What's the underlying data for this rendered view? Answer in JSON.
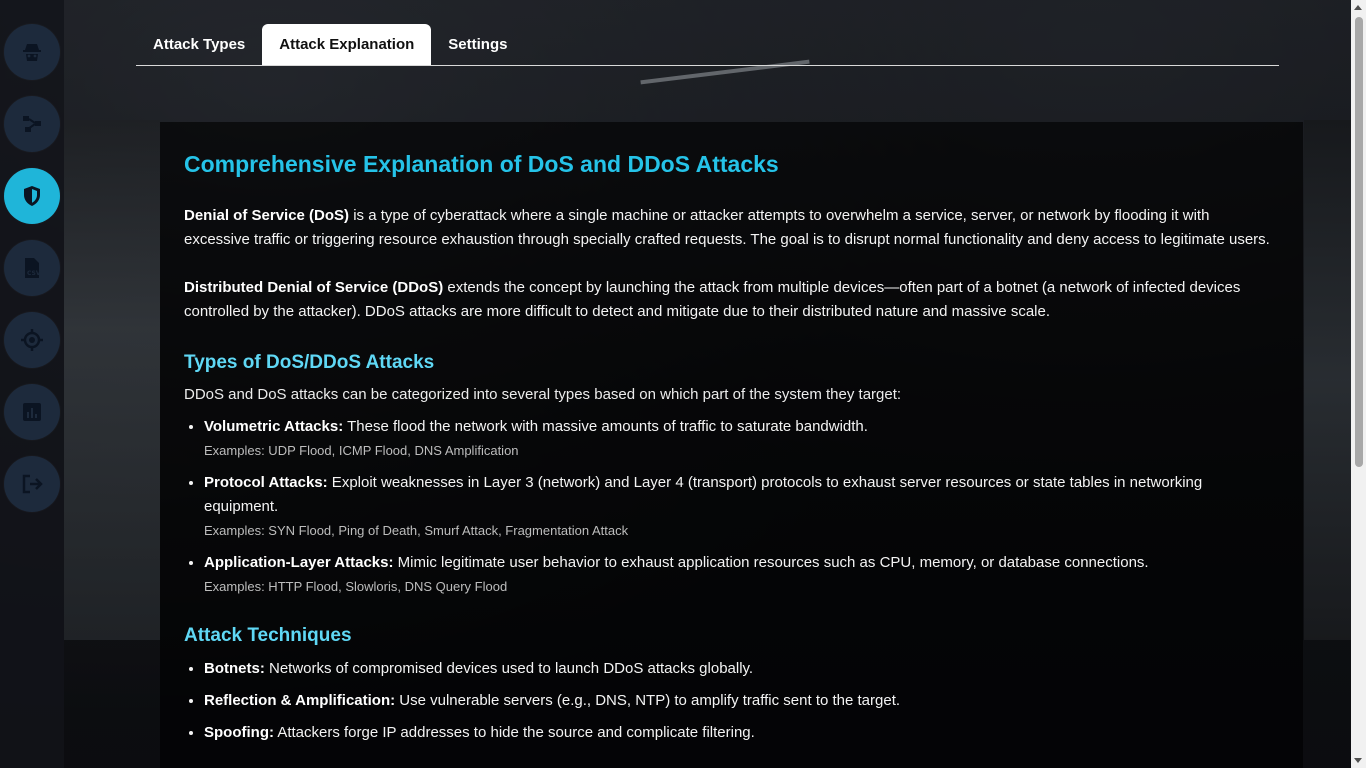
{
  "sidebar": {
    "items": [
      {
        "icon": "spy-icon"
      },
      {
        "icon": "network-icon"
      },
      {
        "icon": "shield-icon",
        "active": true
      },
      {
        "icon": "csv-file-icon"
      },
      {
        "icon": "crosshair-icon"
      },
      {
        "icon": "chart-icon"
      },
      {
        "icon": "logout-icon"
      }
    ],
    "accent_color": "#1fb5d9",
    "button_color": "#1d2a3c"
  },
  "tabs": [
    {
      "label": "Attack Types"
    },
    {
      "label": "Attack Explanation",
      "active": true
    },
    {
      "label": "Settings"
    }
  ],
  "main": {
    "title": "Comprehensive Explanation of DoS and DDoS Attacks",
    "dos": {
      "term": "Denial of Service (DoS)",
      "text": " is a type of cyberattack where a single machine or attacker attempts to overwhelm a service, server, or network by flooding it with excessive traffic or triggering resource exhaustion through specially crafted requests. The goal is to disrupt normal functionality and deny access to legitimate users."
    },
    "ddos": {
      "term": "Distributed Denial of Service (DDoS)",
      "text": " extends the concept by launching the attack from multiple devices—often part of a botnet (a network of infected devices controlled by the attacker). DDoS attacks are more difficult to detect and mitigate due to their distributed nature and massive scale."
    },
    "types": {
      "heading": "Types of DoS/DDoS Attacks",
      "intro": "DDoS and DoS attacks can be categorized into several types based on which part of the system they target:",
      "items": [
        {
          "term": "Volumetric Attacks:",
          "text": " These flood the network with massive amounts of traffic to saturate bandwidth.",
          "examples": "Examples: UDP Flood, ICMP Flood, DNS Amplification"
        },
        {
          "term": "Protocol Attacks:",
          "text": " Exploit weaknesses in Layer 3 (network) and Layer 4 (transport) protocols to exhaust server resources or state tables in networking equipment.",
          "examples": "Examples: SYN Flood, Ping of Death, Smurf Attack, Fragmentation Attack"
        },
        {
          "term": "Application-Layer Attacks:",
          "text": " Mimic legitimate user behavior to exhaust application resources such as CPU, memory, or database connections.",
          "examples": "Examples: HTTP Flood, Slowloris, DNS Query Flood"
        }
      ]
    },
    "techniques": {
      "heading": "Attack Techniques",
      "items": [
        {
          "term": "Botnets:",
          "text": " Networks of compromised devices used to launch DDoS attacks globally."
        },
        {
          "term": "Reflection & Amplification:",
          "text": " Use vulnerable servers (e.g., DNS, NTP) to amplify traffic sent to the target."
        },
        {
          "term": "Spoofing:",
          "text": " Attackers forge IP addresses to hide the source and complicate filtering."
        }
      ]
    },
    "title_color": "#25c3e8",
    "heading_color": "#5fd8f5"
  }
}
